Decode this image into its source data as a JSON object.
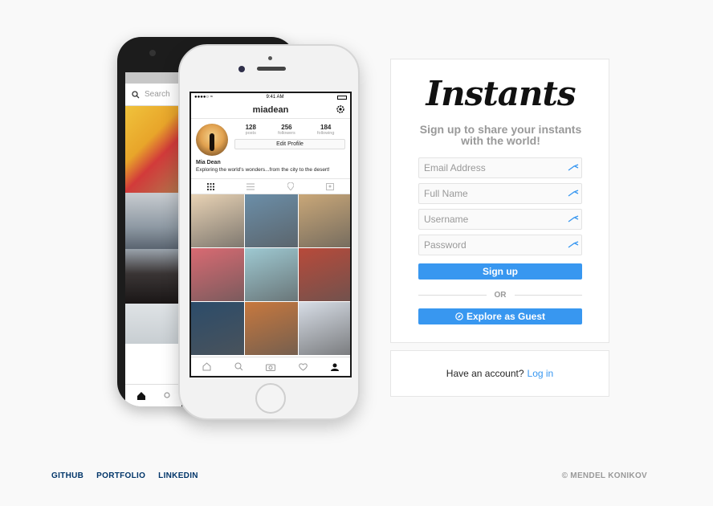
{
  "back_phone": {
    "search_placeholder": "Search"
  },
  "front_phone": {
    "status_time": "9:41 AM",
    "username": "miadean",
    "stats": [
      {
        "num": "128",
        "label": "posts"
      },
      {
        "num": "256",
        "label": "followers"
      },
      {
        "num": "184",
        "label": "following"
      }
    ],
    "edit_profile_label": "Edit Profile",
    "bio_name": "Mia Dean",
    "bio_text": "Exploring the world's wonders...from the city to the desert!",
    "grid_colors": [
      "#e8d2b4",
      "#6b8ea8",
      "#c9a778",
      "#d96a72",
      "#9ec9d2",
      "#b84a3a",
      "#2c4c6a",
      "#c7783e",
      "#d7dde6"
    ]
  },
  "signup": {
    "logo": "Instants",
    "tagline": "Sign up to share your instants with the world!",
    "email_placeholder": "Email Address",
    "fullname_placeholder": "Full Name",
    "username_placeholder": "Username",
    "password_placeholder": "Password",
    "signup_label": "Sign up",
    "or_label": "OR",
    "guest_label": "Explore as Guest"
  },
  "login": {
    "prompt": "Have an account?",
    "link": "Log in"
  },
  "footer": {
    "links": [
      "GITHUB",
      "PORTFOLIO",
      "LINKEDIN"
    ],
    "copyright": "© MENDEL KONIKOV"
  },
  "colors": {
    "accent": "#3897f0",
    "footer_link": "#003569",
    "background": "#f9f9f9"
  }
}
